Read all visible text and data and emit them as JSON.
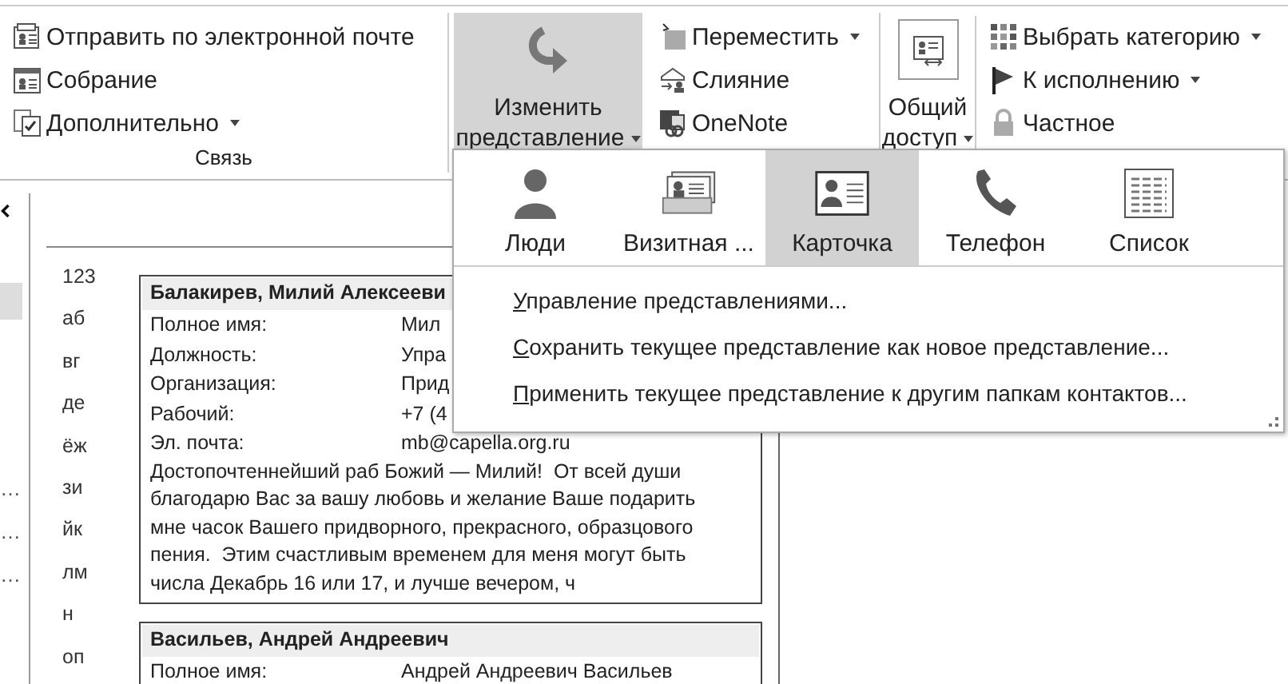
{
  "ribbon": {
    "communicate": {
      "label": "Связь",
      "items": [
        {
          "label": "Отправить по электронной почте",
          "dropdown": false
        },
        {
          "label": "Собрание",
          "dropdown": false
        },
        {
          "label": "Дополнительно",
          "dropdown": true
        }
      ]
    },
    "change_view": {
      "label_lines": [
        "Изменить",
        "представление"
      ],
      "dropdown": true,
      "expanded": true
    },
    "actions": {
      "items": [
        {
          "label": "Переместить",
          "dropdown": true
        },
        {
          "label": "Слияние",
          "dropdown": false
        },
        {
          "label": "OneNote",
          "dropdown": false
        }
      ]
    },
    "share": {
      "label_lines": [
        "Общий",
        "доступ"
      ],
      "dropdown": true
    },
    "tags": {
      "items": [
        {
          "label": "Выбрать категорию",
          "dropdown": true
        },
        {
          "label": "К исполнению",
          "dropdown": true
        },
        {
          "label": "Частное",
          "dropdown": false
        }
      ]
    }
  },
  "folders": [
    {
      "selected": true
    },
    {
      "label": "…",
      "selected": false
    },
    {
      "label": "…",
      "selected": false
    },
    {
      "label": "…",
      "selected": false
    }
  ],
  "index": [
    "123",
    "аб",
    "вг",
    "де",
    "ёж",
    "зи",
    "йк",
    "лм",
    "н",
    "оп"
  ],
  "contacts": [
    {
      "name": "Балакирев, Милий Алексееви",
      "fields": [
        {
          "label": "Полное имя:",
          "value": "Мил"
        },
        {
          "label": "Должность:",
          "value": "Упра"
        },
        {
          "label": "Организация:",
          "value": "Прид"
        },
        {
          "label": "Рабочий:",
          "value": "+7 (4"
        },
        {
          "label": "Эл. почта:",
          "value": "mb@capella.org.ru"
        }
      ],
      "notes": "Достопочтеннейший раб Божий — Милий!  От всей души\nблагодарю Вас за вашу любовь и желание Ваше подарить\nмне часок Вашего придворного, прекрасного, образцового\nпения.  Этим счастливым временем для меня могут быть\nчисла Декабрь 16 или 17, и лучше вечером, ч"
    },
    {
      "name": "Васильев, Андрей Андреевич",
      "fields": [
        {
          "label": "Полное имя:",
          "value": "Андрей Андреевич Васильев"
        }
      ]
    }
  ],
  "view_menu": {
    "views": [
      {
        "label": "Люди",
        "selected": false
      },
      {
        "label": "Визитная ...",
        "selected": false
      },
      {
        "label": "Карточка",
        "selected": true
      },
      {
        "label": "Телефон",
        "selected": false
      },
      {
        "label": "Список",
        "selected": false
      }
    ],
    "commands": [
      "Управление представлениями...",
      "Сохранить текущее представление как новое представление...",
      "Применить текущее представление к другим папкам контактов..."
    ]
  }
}
